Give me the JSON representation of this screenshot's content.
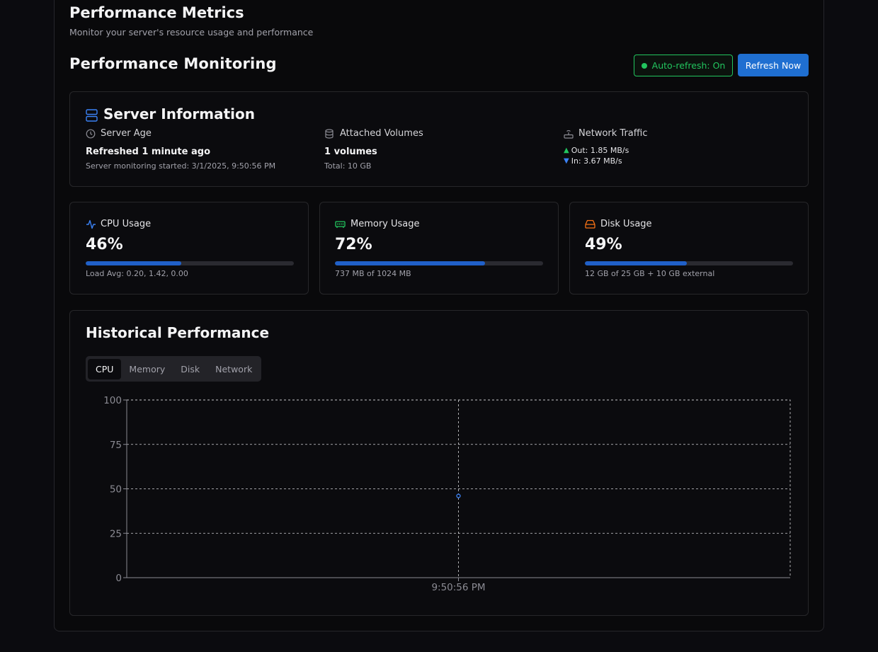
{
  "header": {
    "title": "Performance Metrics",
    "subtitle": "Monitor your server's resource usage and performance"
  },
  "monitoring": {
    "title": "Performance Monitoring",
    "auto_refresh_label": "Auto-refresh: On",
    "refresh_button": "Refresh Now"
  },
  "server_info": {
    "title": "Server Information",
    "age": {
      "label": "Server Age",
      "value": "Refreshed 1 minute ago",
      "detail": "Server monitoring started: 3/1/2025, 9:50:56 PM"
    },
    "volumes": {
      "label": "Attached Volumes",
      "value": "1 volumes",
      "detail": "Total: 10 GB"
    },
    "network": {
      "label": "Network Traffic",
      "out": "Out: 1.85 MB/s",
      "in": "In: 3.67 MB/s"
    }
  },
  "metrics": {
    "cpu": {
      "label": "CPU Usage",
      "value": "46%",
      "percent": 46,
      "detail": "Load Avg: 0.20, 1.42, 0.00"
    },
    "memory": {
      "label": "Memory Usage",
      "value": "72%",
      "percent": 72,
      "detail": "737 MB of 1024 MB"
    },
    "disk": {
      "label": "Disk Usage",
      "value": "49%",
      "percent": 49,
      "detail": "12 GB of 25 GB + 10 GB external"
    }
  },
  "history": {
    "title": "Historical Performance",
    "tabs": [
      "CPU",
      "Memory",
      "Disk",
      "Network"
    ],
    "active_tab": "CPU"
  },
  "colors": {
    "accent": "#1f6fd1",
    "success": "#22c55e",
    "cpu_icon": "#3b82f6",
    "memory_icon": "#22c55e",
    "disk_icon": "#f97316"
  },
  "chart_data": {
    "type": "line",
    "x": [
      "9:50:56 PM"
    ],
    "series": [
      {
        "values": [
          46
        ]
      }
    ],
    "ylim": [
      0,
      100
    ],
    "yticks": [
      0,
      25,
      50,
      75,
      100
    ],
    "grid": true
  }
}
